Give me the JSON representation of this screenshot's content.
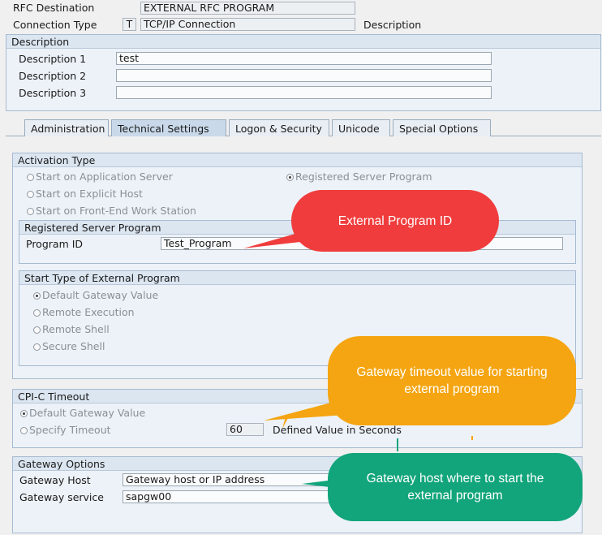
{
  "header": {
    "rfc_destination_label": "RFC Destination",
    "rfc_destination_value": "EXTERNAL RFC PROGRAM",
    "connection_type_label": "Connection Type",
    "connection_type_code": "T",
    "connection_type_value": "TCP/IP Connection",
    "connection_type_description": "Description"
  },
  "description_group": {
    "title": "Description",
    "rows": [
      {
        "label": "Description 1",
        "value": "test"
      },
      {
        "label": "Description 2",
        "value": ""
      },
      {
        "label": "Description 3",
        "value": ""
      }
    ]
  },
  "tabs": [
    {
      "label": "Administration"
    },
    {
      "label": "Technical Settings"
    },
    {
      "label": "Logon & Security"
    },
    {
      "label": "Unicode"
    },
    {
      "label": "Special Options"
    }
  ],
  "activation_type": {
    "title": "Activation Type",
    "options": [
      {
        "label": "Start on Application Server",
        "selected": false
      },
      {
        "label": "Registered Server Program",
        "selected": true
      },
      {
        "label": "Start on Explicit Host",
        "selected": false
      },
      {
        "label": "Start on Front-End Work Station",
        "selected": false
      }
    ],
    "registered_server_program": {
      "title": "Registered Server Program",
      "program_id_label": "Program ID",
      "program_id_value": "Test_Program"
    },
    "start_type": {
      "title": "Start Type of External Program",
      "options": [
        {
          "label": "Default Gateway Value",
          "selected": true
        },
        {
          "label": "Remote Execution",
          "selected": false
        },
        {
          "label": "Remote Shell",
          "selected": false
        },
        {
          "label": "Secure Shell",
          "selected": false
        }
      ]
    }
  },
  "cpic_timeout": {
    "title": "CPI-C Timeout",
    "options": [
      {
        "label": "Default Gateway Value",
        "selected": true
      },
      {
        "label": "Specify Timeout",
        "selected": false
      }
    ],
    "timeout_value": "60",
    "timeout_unit_label": "Defined Value in Seconds"
  },
  "gateway_options": {
    "title": "Gateway Options",
    "host_label": "Gateway Host",
    "host_value": "Gateway host or IP address",
    "service_label": "Gateway service",
    "service_value": "sapgw00"
  },
  "callouts": {
    "program_id": "External Program ID",
    "timeout": "Gateway timeout value for starting external program",
    "gateway_host": "Gateway host where to start the external program"
  },
  "colors": {
    "callout_red": "#f03c3c",
    "callout_orange": "#f5a511",
    "callout_green": "#12a57b",
    "group_header": "#dce6f1",
    "active_tab": "#c9d9ea"
  }
}
